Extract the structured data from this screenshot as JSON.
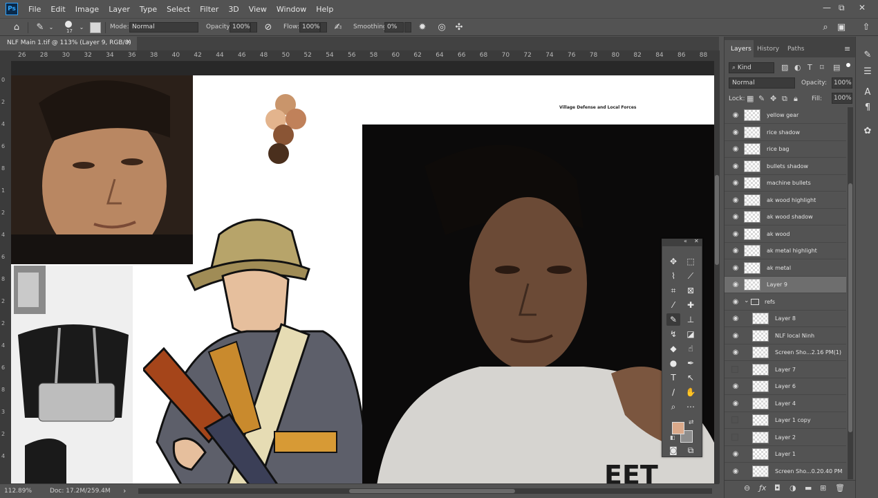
{
  "app": {
    "logo": "Ps"
  },
  "menu": [
    "File",
    "Edit",
    "Image",
    "Layer",
    "Type",
    "Select",
    "Filter",
    "3D",
    "View",
    "Window",
    "Help"
  ],
  "window_controls": {
    "minimize": "—",
    "restore": "⧉",
    "close": "✕"
  },
  "options": {
    "brush_size": "17",
    "mode_label": "Mode:",
    "mode_value": "Normal",
    "opacity_label": "Opacity:",
    "opacity_value": "100%",
    "flow_label": "Flow:",
    "flow_value": "100%",
    "smoothing_label": "Smoothing:",
    "smoothing_value": "0%"
  },
  "document_tab": {
    "title": "NLF Main 1.tif @ 113% (Layer 9, RGB/8)",
    "close": "×"
  },
  "ruler_h": [
    "26",
    "28",
    "30",
    "32",
    "34",
    "36",
    "38",
    "40",
    "42",
    "44",
    "46",
    "48",
    "50",
    "52",
    "54",
    "56",
    "58",
    "60",
    "62",
    "64",
    "66",
    "68",
    "70",
    "72",
    "74",
    "76",
    "78",
    "80",
    "82",
    "84",
    "86",
    "88"
  ],
  "ruler_v": [
    "0",
    "2",
    "4",
    "6",
    "8",
    "1",
    "2",
    "4",
    "6",
    "8",
    "2",
    "2",
    "4",
    "6",
    "8",
    "3",
    "2",
    "4"
  ],
  "canvas": {
    "reference_heading": "Village Defense and Local Forces",
    "swatch_colors": [
      "#c9956b",
      "#e3b48d",
      "#c0815a",
      "#8a5535",
      "#4a2f1d"
    ],
    "shirt_text": "EET"
  },
  "status": {
    "zoom": "112.89%",
    "doc": "Doc: 17.2M/259.4M",
    "arrow": "›"
  },
  "panel_tabs": [
    "Layers",
    "History",
    "Paths"
  ],
  "layers_panel": {
    "kind_label": "Kind",
    "blend_mode": "Normal",
    "opacity_label": "Opacity:",
    "opacity_value": "100%",
    "lock_label": "Lock:",
    "fill_label": "Fill:",
    "fill_value": "100%"
  },
  "layers": [
    {
      "name": "yellow gear",
      "visible": true,
      "indent": false
    },
    {
      "name": "rice shadow",
      "visible": true,
      "indent": false
    },
    {
      "name": "rice bag",
      "visible": true,
      "indent": false
    },
    {
      "name": "bullets shadow",
      "visible": true,
      "indent": false
    },
    {
      "name": "machine bullets",
      "visible": true,
      "indent": false
    },
    {
      "name": "ak wood highlight",
      "visible": true,
      "indent": false
    },
    {
      "name": "ak wood shadow",
      "visible": true,
      "indent": false
    },
    {
      "name": "ak wood",
      "visible": true,
      "indent": false
    },
    {
      "name": "ak metal highlight",
      "visible": true,
      "indent": false
    },
    {
      "name": "ak metal",
      "visible": true,
      "indent": false
    },
    {
      "name": "Layer 9",
      "visible": true,
      "indent": false,
      "selected": true
    },
    {
      "name": "refs",
      "visible": true,
      "group": true
    },
    {
      "name": "Layer 8",
      "visible": true,
      "indent": true
    },
    {
      "name": "NLF local Ninh",
      "visible": true,
      "indent": true
    },
    {
      "name": "Screen Sho...2.16 PM(1)",
      "visible": true,
      "indent": true
    },
    {
      "name": "Layer 7",
      "visible": false,
      "indent": true
    },
    {
      "name": "Layer 6",
      "visible": true,
      "indent": true
    },
    {
      "name": "Layer 4",
      "visible": true,
      "indent": true
    },
    {
      "name": "Layer 1 copy",
      "visible": false,
      "indent": true
    },
    {
      "name": "Layer 2",
      "visible": false,
      "indent": true
    },
    {
      "name": "Layer 1",
      "visible": true,
      "indent": true
    },
    {
      "name": "Screen Sho...0.20.40 PM",
      "visible": true,
      "indent": true
    }
  ],
  "panel_footer_icons": [
    "link-icon",
    "fx-icon",
    "mask-icon",
    "adjustment-icon",
    "folder-icon",
    "new-layer-icon",
    "trash-icon"
  ],
  "colors": {
    "foreground": "#dba98a",
    "background": "#8d8d8d",
    "ui_dark": "#535353",
    "selection": "#6e6e6e"
  }
}
